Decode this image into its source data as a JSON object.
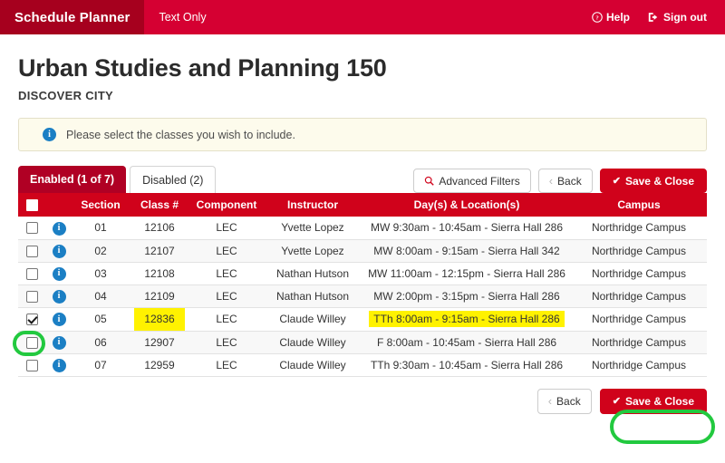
{
  "navbar": {
    "brand": "Schedule Planner",
    "text_only": "Text Only",
    "help": "Help",
    "help_icon": "question-circle-icon",
    "sign_out": "Sign out",
    "sign_out_icon": "sign-out-icon",
    "bg_color": "#d50032",
    "brand_bg_color": "#a6001e"
  },
  "header": {
    "course_title": "Urban Studies and Planning 150",
    "course_subtitle": "DISCOVER CITY"
  },
  "alert": {
    "icon": "info-icon",
    "message": "Please select the classes you wish to include.",
    "bg_color": "#fdfbec",
    "icon_color": "#1b7fc4"
  },
  "toolbar": {
    "tabs": [
      {
        "label": "Enabled (1 of 7)",
        "active": true
      },
      {
        "label": "Disabled (2)",
        "active": false
      }
    ],
    "advanced_filters_label": "Advanced Filters",
    "advanced_filters_icon": "search-icon",
    "back_label": "Back",
    "back_icon": "chevron-left-icon",
    "save_close_label": "Save & Close",
    "save_close_icon": "check-icon",
    "primary_color": "#d0021b"
  },
  "table": {
    "columns": [
      "",
      "",
      "Section",
      "Class #",
      "Component",
      "Instructor",
      "Day(s) & Location(s)",
      "Campus"
    ],
    "header_checkbox_checked": false,
    "rows": [
      {
        "checked": false,
        "info_icon": "info-icon",
        "section": "01",
        "class_num": "12106",
        "component": "LEC",
        "instructor": "Yvette Lopez",
        "day_location": "MW 9:30am - 10:45am - Sierra Hall 286",
        "campus": "Northridge Campus",
        "class_num_highlighted": false,
        "day_location_highlighted": false
      },
      {
        "checked": false,
        "info_icon": "info-icon",
        "section": "02",
        "class_num": "12107",
        "component": "LEC",
        "instructor": "Yvette Lopez",
        "day_location": "MW 8:00am - 9:15am - Sierra Hall 342",
        "campus": "Northridge Campus",
        "class_num_highlighted": false,
        "day_location_highlighted": false
      },
      {
        "checked": false,
        "info_icon": "info-icon",
        "section": "03",
        "class_num": "12108",
        "component": "LEC",
        "instructor": "Nathan Hutson",
        "day_location": "MW 11:00am - 12:15pm - Sierra Hall 286",
        "campus": "Northridge Campus",
        "class_num_highlighted": false,
        "day_location_highlighted": false
      },
      {
        "checked": false,
        "info_icon": "info-icon",
        "section": "04",
        "class_num": "12109",
        "component": "LEC",
        "instructor": "Nathan Hutson",
        "day_location": "MW 2:00pm - 3:15pm - Sierra Hall 286",
        "campus": "Northridge Campus",
        "class_num_highlighted": false,
        "day_location_highlighted": false
      },
      {
        "checked": true,
        "info_icon": "info-icon",
        "section": "05",
        "class_num": "12836",
        "component": "LEC",
        "instructor": "Claude Willey",
        "day_location": "TTh 8:00am - 9:15am - Sierra Hall 286",
        "campus": "Northridge Campus",
        "class_num_highlighted": true,
        "day_location_highlighted": true
      },
      {
        "checked": false,
        "info_icon": "info-icon",
        "section": "06",
        "class_num": "12907",
        "component": "LEC",
        "instructor": "Claude Willey",
        "day_location": "F 8:00am - 10:45am - Sierra Hall 286",
        "campus": "Northridge Campus",
        "class_num_highlighted": false,
        "day_location_highlighted": false
      },
      {
        "checked": false,
        "info_icon": "info-icon",
        "section": "07",
        "class_num": "12959",
        "component": "LEC",
        "instructor": "Claude Willey",
        "day_location": "TTh 9:30am - 10:45am - Sierra Hall 286",
        "campus": "Northridge Campus",
        "class_num_highlighted": false,
        "day_location_highlighted": false
      }
    ],
    "highlight_color": "#fff200",
    "header_bg_color": "#d0021b"
  },
  "footer": {
    "back_label": "Back",
    "back_icon": "chevron-left-icon",
    "save_close_label": "Save & Close",
    "save_close_icon": "check-icon"
  },
  "annotations": {
    "ring_color": "#22c93f",
    "targets": [
      "row-05-checkbox",
      "footer-save-close-button"
    ]
  }
}
